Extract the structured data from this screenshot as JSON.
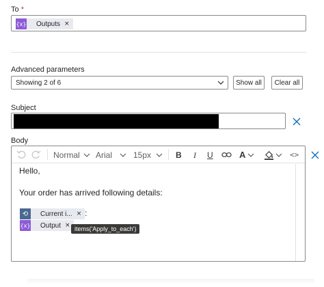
{
  "to_field": {
    "label": "To",
    "required_mark": "*",
    "token": {
      "label": "Outputs",
      "icon": "expression-icon",
      "remove": "×"
    }
  },
  "advanced": {
    "label": "Advanced parameters",
    "select_value": "Showing 2 of 6",
    "show_all": "Show all",
    "clear_all": "Clear all"
  },
  "subject": {
    "label": "Subject",
    "value": "",
    "clear_icon": "×"
  },
  "body": {
    "label": "Body",
    "toolbar": {
      "undo_icon": "undo-icon",
      "redo_icon": "redo-icon",
      "style": "Normal",
      "font": "Arial",
      "size": "15px",
      "bold": "B",
      "italic": "I",
      "underline": "U",
      "font_color": "A",
      "code": "<>"
    },
    "content": {
      "line1": "Hello,",
      "line2": "Your order has arrived following details:",
      "token_current": {
        "label": "Current i...",
        "remove": "×",
        "suffix": ":"
      },
      "token_output": {
        "label": "Output",
        "remove": "×"
      },
      "tooltip": "items('Apply_to_each')"
    },
    "remove_icon": "×"
  },
  "colors": {
    "accent": "#0f6cbd",
    "token_loop": "#486991",
    "token_expression": "#8d5bd8",
    "redaction": "#000000"
  }
}
